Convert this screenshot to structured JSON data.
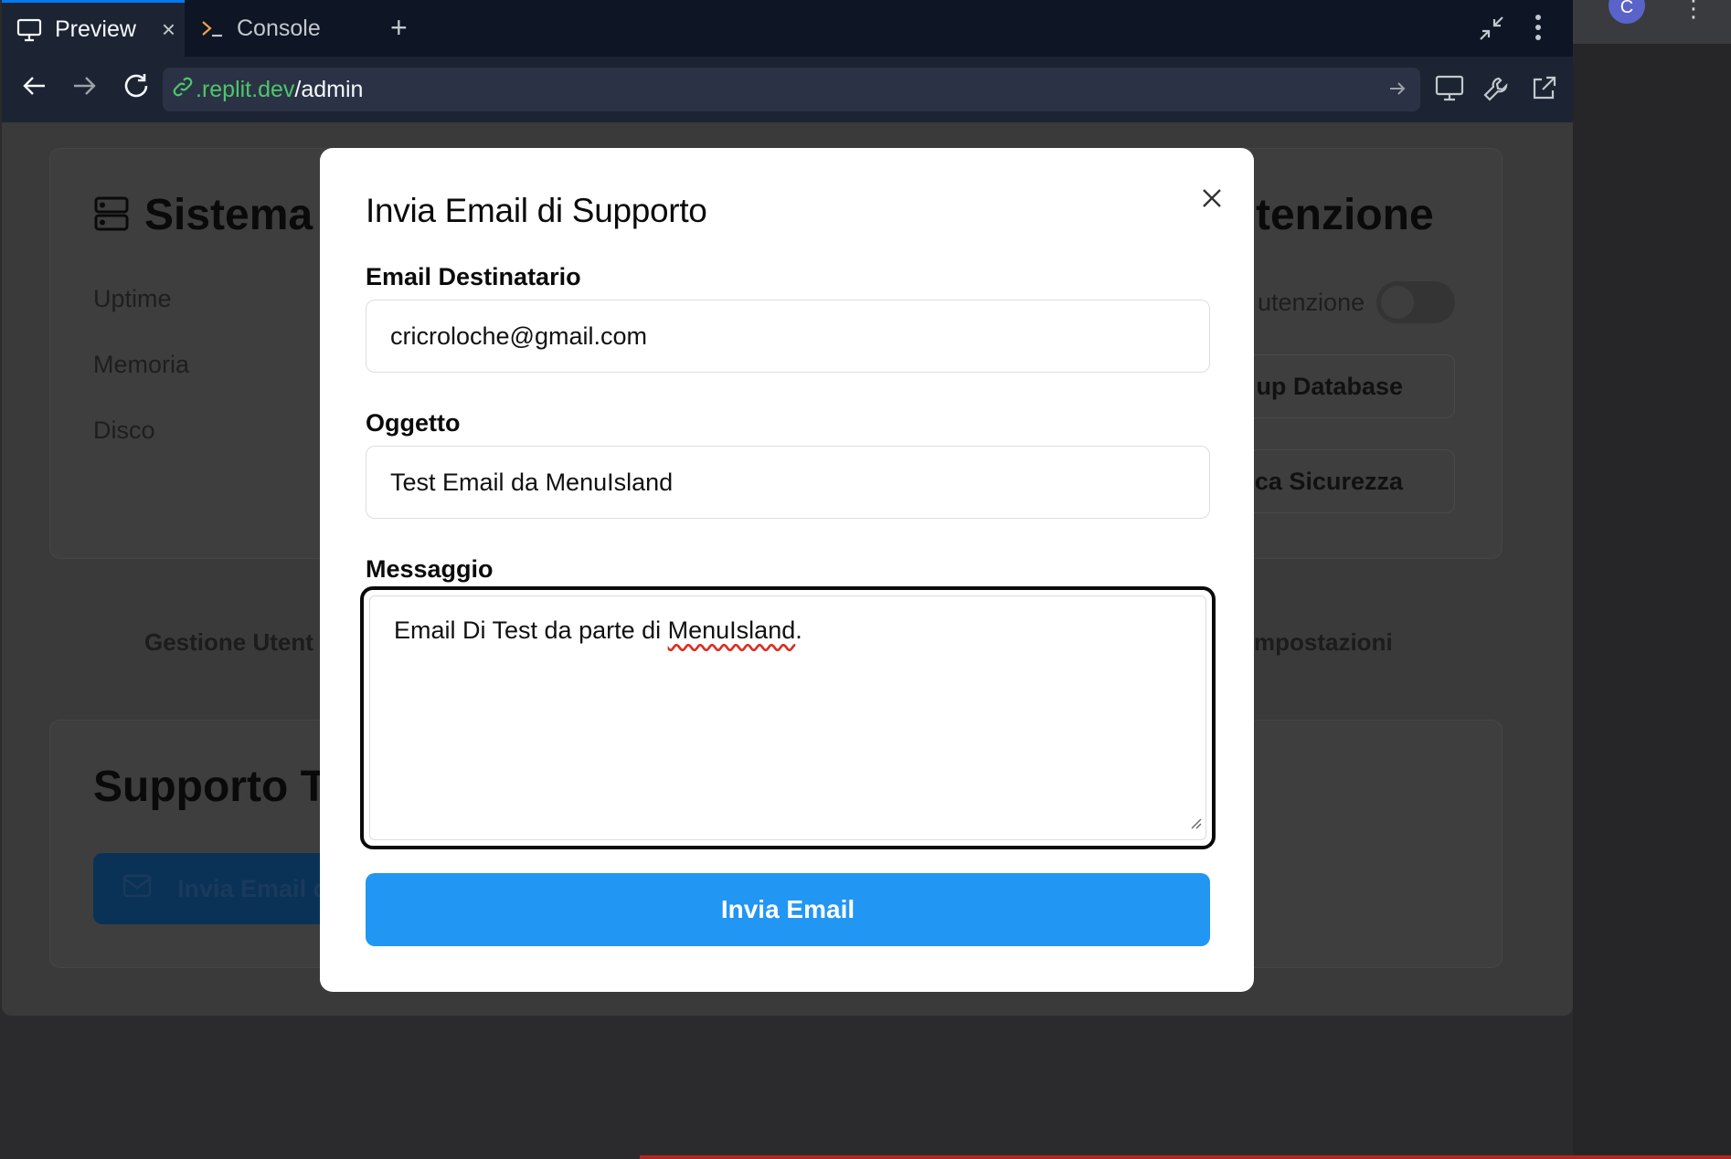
{
  "browser": {
    "tabs": [
      {
        "label": "Preview"
      },
      {
        "label": "Console"
      }
    ],
    "url_prefix": "",
    "url_host": ".replit.dev",
    "url_path": "/admin",
    "avatar_initial": "C"
  },
  "background": {
    "system_title": "Sistema",
    "system_rows": [
      "Uptime",
      "Memoria",
      "Disco"
    ],
    "maintenance_title": "tenzione",
    "maintenance_toggle_label": "utenzione",
    "maintenance_toggle_on": false,
    "maintenance_buttons": [
      "up Database",
      "fica Sicurezza"
    ],
    "nav_left": "Gestione Utent",
    "nav_right": "mpostazioni",
    "support_title": "Supporto Te",
    "support_button": "Invia Email d"
  },
  "modal": {
    "title": "Invia Email di Supporto",
    "recipient_label": "Email Destinatario",
    "recipient_value": "cricroloche@gmail.com",
    "subject_label": "Oggetto",
    "subject_value": "Test Email da MenuIsland",
    "message_label": "Messaggio",
    "message_before": "Email Di Test da parte di ",
    "message_misspelled": "MenuIsland",
    "message_after": ".",
    "submit_label": "Invia Email"
  },
  "colors": {
    "accent": "#2196f3",
    "url_host": "#4ec66b",
    "active_tab": "#0079f2"
  }
}
